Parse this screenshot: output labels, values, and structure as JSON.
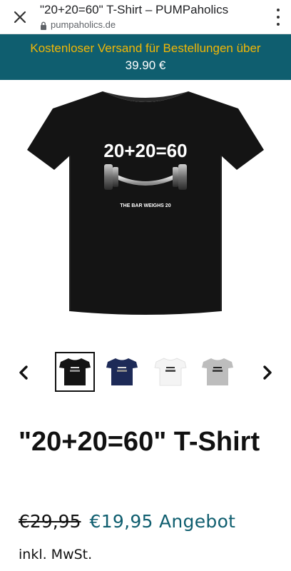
{
  "browser": {
    "page_title": "\"20+20=60\" T-Shirt – PUMPaholics",
    "url": "pumpaholics.de",
    "close_icon": "close-icon",
    "menu_icon": "more-vert-icon"
  },
  "banner": {
    "line1": "Kostenloser Versand für Bestellungen über",
    "line2": "39.90 €",
    "colors": {
      "background": "#0f5e6f",
      "line1": "#f2b705",
      "line2": "#ffffff"
    }
  },
  "product": {
    "image": {
      "shirt_color": "#111111",
      "print_title": "20+20=60",
      "print_caption": "THE BAR WEIGHS 20"
    },
    "thumbnails": [
      {
        "color": "#111111",
        "selected": true
      },
      {
        "color": "#1d2a57",
        "selected": false
      },
      {
        "color": "#f4f4f4",
        "selected": false
      },
      {
        "color": "#bdbdbd",
        "selected": false
      }
    ],
    "title": "\"20+20=60\" T-Shirt",
    "old_price": "€29,95",
    "new_price": "€19,95 Angebot",
    "tax_note": "inkl. MwSt.",
    "accent_color": "#0f5e6f"
  }
}
